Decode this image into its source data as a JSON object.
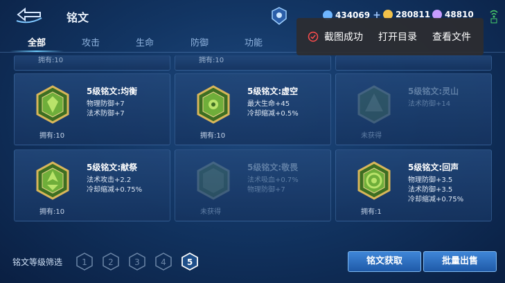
{
  "header": {
    "title": "铭文",
    "currencies": [
      {
        "icon": "diamond-icon",
        "value": "434069",
        "color": "#6fb6ff"
      },
      {
        "icon": "gold-coin-icon",
        "value": "280811",
        "color": "#f1c14a"
      },
      {
        "icon": "crystal-icon",
        "value": "48810",
        "color": "#c79cff"
      }
    ]
  },
  "tabs": [
    {
      "label": "全部",
      "active": true
    },
    {
      "label": "攻击",
      "active": false
    },
    {
      "label": "生命",
      "active": false
    },
    {
      "label": "防御",
      "active": false
    },
    {
      "label": "功能",
      "active": false
    }
  ],
  "partial_row": {
    "owned_text": "拥有:10"
  },
  "cards": [
    {
      "name": "5级铭文:均衡",
      "stats": [
        "物理防御+7",
        "法术防御+7"
      ],
      "owned": "拥有:10",
      "locked": false
    },
    {
      "name": "5级铭文:虚空",
      "stats": [
        "最大生命+45",
        "冷却缩减+0.5%"
      ],
      "owned": "拥有:10",
      "locked": false
    },
    {
      "name": "5级铭文:灵山",
      "stats": [
        "法术防御+14"
      ],
      "owned": "未获得",
      "locked": true
    },
    {
      "name": "5级铭文:献祭",
      "stats": [
        "法术攻击+2.2",
        "冷却缩减+0.75%"
      ],
      "owned": "拥有:10",
      "locked": false
    },
    {
      "name": "5级铭文:敬畏",
      "stats": [
        "法术吸血+0.7%",
        "物理防御+7"
      ],
      "owned": "未获得",
      "locked": true
    },
    {
      "name": "5级铭文:回声",
      "stats": [
        "物理防御+3.5",
        "法术防御+3.5",
        "冷却缩减+0.75%"
      ],
      "owned": "拥有:1",
      "locked": false
    }
  ],
  "filter": {
    "label": "铭文等级筛选",
    "levels": [
      "1",
      "2",
      "3",
      "4",
      "5"
    ],
    "selected": "5"
  },
  "buttons": {
    "acquire": "铭文获取",
    "bulk_sell": "批量出售"
  },
  "toast": {
    "message": "截图成功",
    "open_dir": "打开目录",
    "view_file": "查看文件"
  },
  "colors": {
    "accent": "#6fd0ff",
    "rune_green": "#6fae3a",
    "rune_gold": "#d8b65a"
  }
}
